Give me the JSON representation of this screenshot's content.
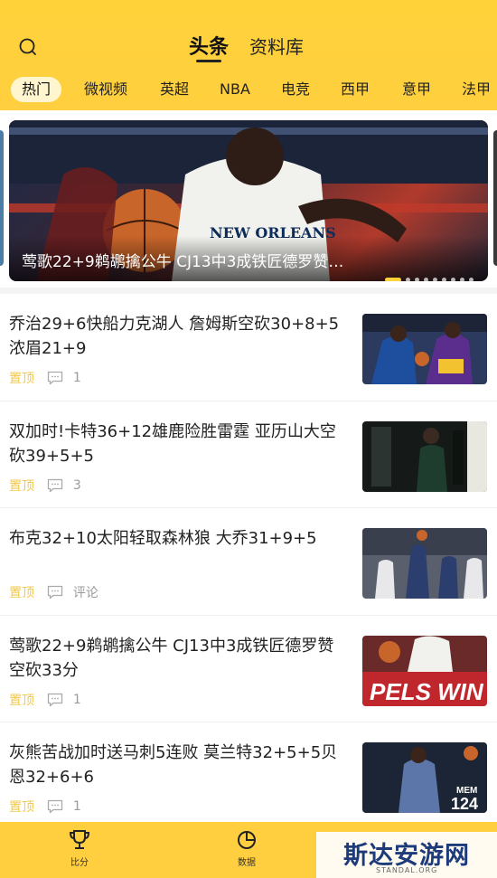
{
  "header": {
    "tabs": [
      {
        "label": "头条",
        "active": true
      },
      {
        "label": "资料库",
        "active": false
      }
    ]
  },
  "categories": [
    "热门",
    "微视频",
    "英超",
    "NBA",
    "电竞",
    "西甲",
    "意甲",
    "法甲"
  ],
  "banner": {
    "caption": "莺歌22+9鹈鹕擒公牛 CJ13中3成铁匠德罗赞…",
    "slide_count": 9,
    "active_slide": 1
  },
  "news": [
    {
      "title": "乔治29+6快船力克湖人 詹姆斯空砍30+8+5浓眉21+9",
      "pin": "置顶",
      "comments": "1"
    },
    {
      "title": "双加时!卡特36+12雄鹿险胜雷霆 亚历山大空砍39+5+5",
      "pin": "置顶",
      "comments": "3"
    },
    {
      "title": "布克32+10太阳轻取森林狼 大乔31+9+5",
      "pin": "置顶",
      "comments": "评论"
    },
    {
      "title": "莺歌22+9鹈鹕擒公牛 CJ13中3成铁匠德罗赞空砍33分",
      "pin": "置顶",
      "comments": "1"
    },
    {
      "title": "灰熊苦战加时送马刺5连败 莫兰特32+5+5贝恩32+6+6",
      "pin": "置顶",
      "comments": "1"
    }
  ],
  "thumb_texts": {
    "pels": "PELS WIN",
    "mem": "MEM",
    "num": "124"
  },
  "bottom_nav": [
    {
      "label": "比分",
      "icon": "trophy-icon"
    },
    {
      "label": "数据",
      "icon": "pie-chart-icon"
    }
  ],
  "watermark": {
    "text": "斯达安游网",
    "sub": "STANDAL.ORG"
  },
  "colors": {
    "accent": "#ffcf3f",
    "pin": "#f2c94c"
  }
}
